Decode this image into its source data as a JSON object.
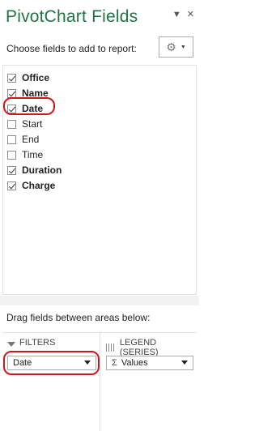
{
  "pane": {
    "title": "PivotChart Fields",
    "dropdown_icon": "chevron-down-icon",
    "close_icon": "close-icon",
    "choose_label": "Choose fields to add to report:",
    "tools_icon": "gear-icon"
  },
  "fields": [
    {
      "label": "Office",
      "checked": true,
      "bold": true
    },
    {
      "label": "Name",
      "checked": true,
      "bold": true
    },
    {
      "label": "Date",
      "checked": true,
      "bold": true
    },
    {
      "label": "Start",
      "checked": false,
      "bold": false
    },
    {
      "label": "End",
      "checked": false,
      "bold": false
    },
    {
      "label": "Time",
      "checked": false,
      "bold": false
    },
    {
      "label": "Duration",
      "checked": true,
      "bold": true
    },
    {
      "label": "Charge",
      "checked": true,
      "bold": true
    }
  ],
  "areas": {
    "drag_label": "Drag fields between areas below:",
    "filters": {
      "title": "FILTERS",
      "item": "Date"
    },
    "legend": {
      "title": "LEGEND (SERIES)",
      "item": "Values",
      "sigma": "Σ"
    }
  },
  "colors": {
    "accent": "#217346",
    "annotation": "#d0161b"
  }
}
